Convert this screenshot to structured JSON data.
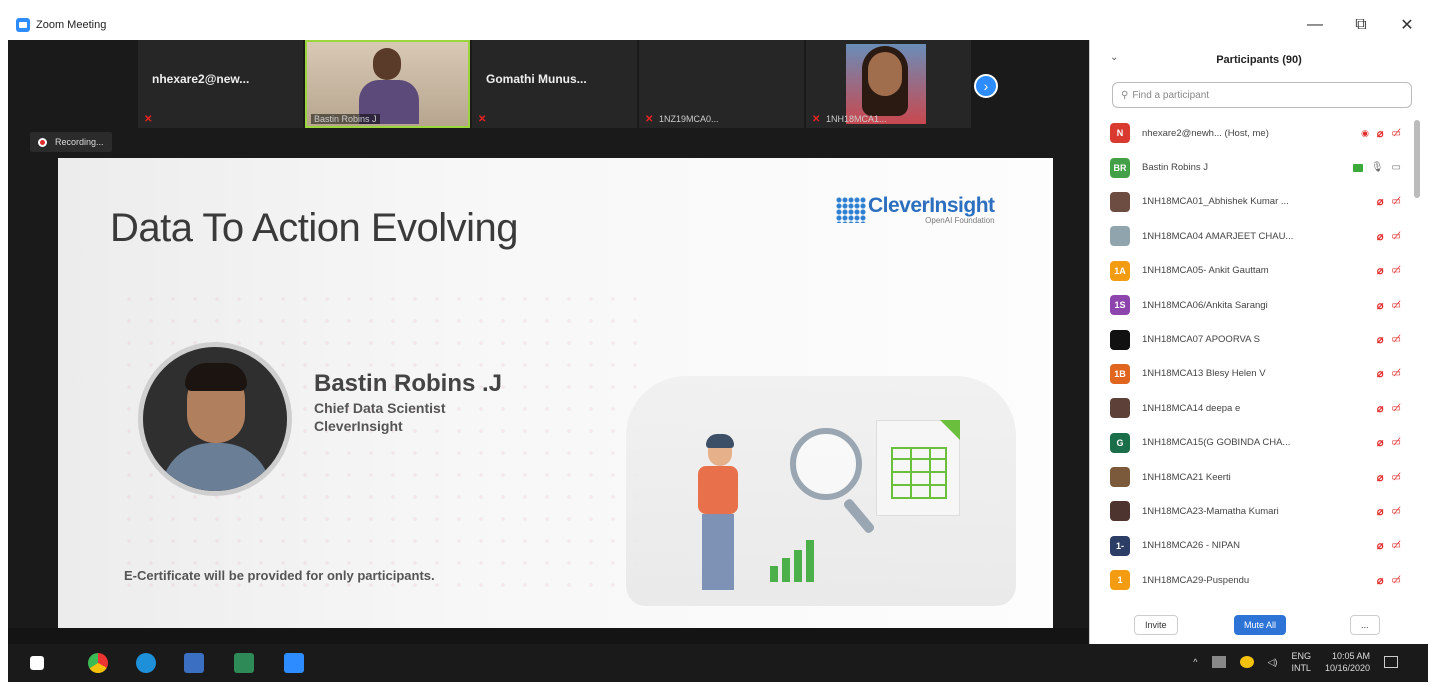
{
  "window": {
    "title": "Zoom Meeting",
    "controls": [
      "—",
      "⧉",
      "✕"
    ]
  },
  "gallery": {
    "tiles": [
      {
        "name": "nhexare2@new...",
        "label": ""
      },
      {
        "name": "",
        "label": "Bastin Robins J"
      },
      {
        "name": "Gomathi  Munus...",
        "label": ""
      },
      {
        "name": "",
        "label": "1NZ19MCA0..."
      },
      {
        "name": "",
        "label": "1NH18MCA1..."
      }
    ],
    "next": "›"
  },
  "recording": {
    "label": "Recording..."
  },
  "slide": {
    "title": "Data To Action Evolving",
    "logo_name": "CleverInsight",
    "logo_sub": "OpenAI Foundation",
    "speaker_name": "Bastin Robins .J",
    "speaker_role": "Chief Data Scientist",
    "speaker_org": "CleverInsight",
    "footer": "E-Certificate will be provided for only participants."
  },
  "participants": {
    "title": "Participants (90)",
    "collapse": "⌄",
    "search_placeholder": "Find a participant",
    "rows": [
      {
        "initials": "N",
        "color": "#d93a2f",
        "name": "nhexare2@newh...  (Host, me)",
        "mic": "off",
        "cam": "off",
        "rec": true
      },
      {
        "initials": "BR",
        "color": "#43a047",
        "name": "Bastin Robins J",
        "mic": "on",
        "cam": "on",
        "share": true
      },
      {
        "initials": "",
        "color": "#6d4c41",
        "name": "1NH18MCA01_Abhishek Kumar ...",
        "mic": "off",
        "cam": "off",
        "photo": true
      },
      {
        "initials": "",
        "color": "#90a4ae",
        "name": "1NH18MCA04 AMARJEET CHAU...",
        "mic": "off",
        "cam": "off",
        "photo": true
      },
      {
        "initials": "1A",
        "color": "#f39c12",
        "name": "1NH18MCA05- Ankit Gauttam",
        "mic": "off",
        "cam": "off"
      },
      {
        "initials": "1S",
        "color": "#8e44ad",
        "name": "1NH18MCA06/Ankita Sarangi",
        "mic": "off",
        "cam": "off"
      },
      {
        "initials": "",
        "color": "#111111",
        "name": "1NH18MCA07 APOORVA S",
        "mic": "off",
        "cam": "off"
      },
      {
        "initials": "1B",
        "color": "#e0651f",
        "name": "1NH18MCA13 Blesy Helen V",
        "mic": "off",
        "cam": "off"
      },
      {
        "initials": "",
        "color": "#5d4037",
        "name": "1NH18MCA14 deepa e",
        "mic": "off",
        "cam": "off",
        "photo": true
      },
      {
        "initials": "G",
        "color": "#1b6e4a",
        "name": "1NH18MCA15(G GOBINDA CHA...",
        "mic": "off",
        "cam": "off"
      },
      {
        "initials": "",
        "color": "#7a5a3a",
        "name": "1NH18MCA21 Keerti",
        "mic": "off",
        "cam": "off",
        "photo": true
      },
      {
        "initials": "",
        "color": "#4e342e",
        "name": "1NH18MCA23-Mamatha Kumari",
        "mic": "off",
        "cam": "off",
        "photo": true
      },
      {
        "initials": "1-",
        "color": "#2c3e66",
        "name": "1NH18MCA26 - NIPAN",
        "mic": "off",
        "cam": "off"
      },
      {
        "initials": "1",
        "color": "#f39c12",
        "name": "1NH18MCA29-Puspendu",
        "mic": "off",
        "cam": "off"
      }
    ],
    "invite": "Invite",
    "mute_all": "Mute All",
    "more": "..."
  },
  "taskbar": {
    "lang_top": "ENG",
    "lang_bottom": "INTL",
    "time": "10:05 AM",
    "date": "10/16/2020"
  }
}
